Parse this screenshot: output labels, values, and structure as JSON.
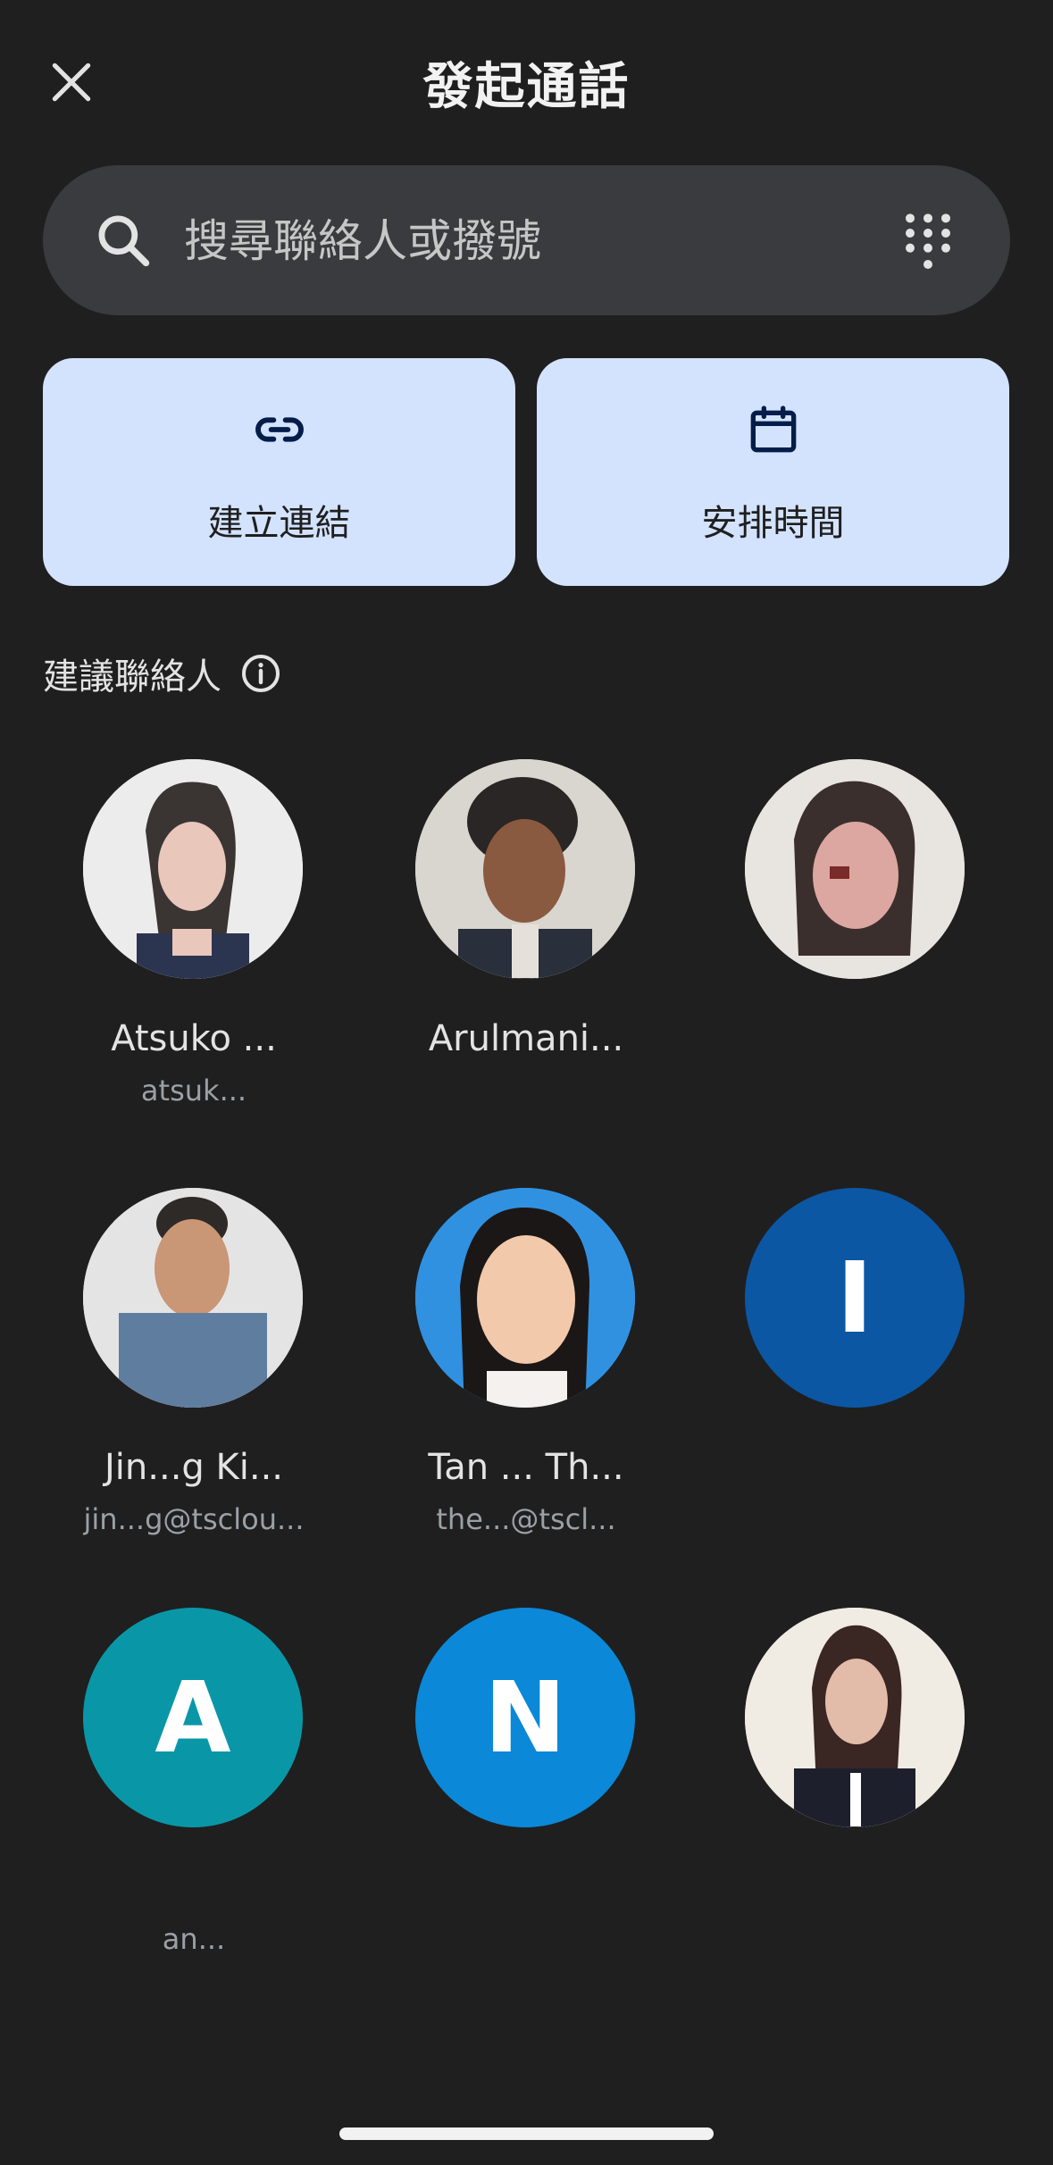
{
  "header": {
    "title": "發起通話"
  },
  "search": {
    "placeholder": "搜尋聯絡人或撥號"
  },
  "actions": [
    {
      "label": "建立連結",
      "icon": "link-icon"
    },
    {
      "label": "安排時間",
      "icon": "calendar-icon"
    }
  ],
  "section": {
    "title": "建議聯絡人"
  },
  "contacts": [
    {
      "name": "Atsuko ...",
      "email": "atsuk...",
      "initial": ""
    },
    {
      "name": "Arulmani...",
      "email": "",
      "initial": ""
    },
    {
      "name": "",
      "email": "",
      "initial": ""
    },
    {
      "name": "Jin...g Ki...",
      "email": "jin...g@tsclou...",
      "initial": ""
    },
    {
      "name": "Tan ... Th...",
      "email": "the...@tscl...",
      "initial": ""
    },
    {
      "name": "",
      "email": "",
      "initial": "I"
    },
    {
      "name": "",
      "email": "an...",
      "initial": "A"
    },
    {
      "name": "",
      "email": "",
      "initial": "N"
    },
    {
      "name": "",
      "email": "",
      "initial": ""
    }
  ],
  "colors": {
    "background": "#1f1f1f",
    "search_bg": "#3a3b3e",
    "action_bg": "#d3e3fd",
    "avatar_initial_I": "#0b57a4",
    "avatar_initial_A": "#0997a8",
    "avatar_initial_N": "#0b88d8"
  }
}
